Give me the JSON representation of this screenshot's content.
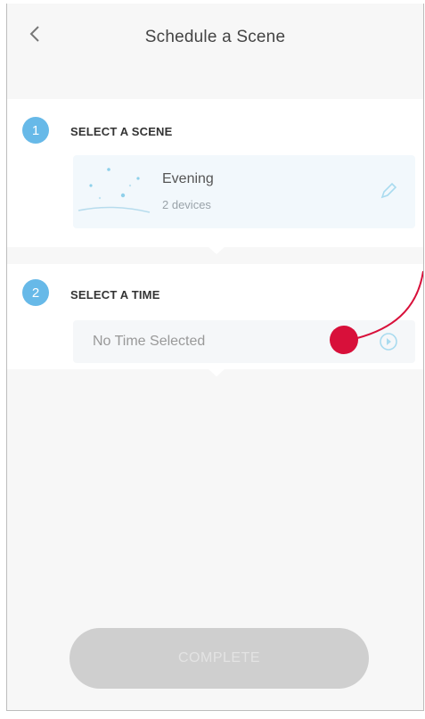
{
  "header": {
    "title": "Schedule a Scene",
    "back_icon": "chevron-left-icon"
  },
  "steps": [
    {
      "number": "1",
      "label": "SELECT A SCENE"
    },
    {
      "number": "2",
      "label": "SELECT A TIME"
    }
  ],
  "scene": {
    "name": "Evening",
    "devices": "2 devices",
    "edit_icon": "pencil-icon",
    "art_icon": "sparkle-scene-icon"
  },
  "time": {
    "value": "No Time Selected",
    "expand_icon": "circle-arrow-right-icon"
  },
  "footer": {
    "complete_label": "COMPLETE"
  },
  "colors": {
    "accent": "#67b9e8",
    "marker": "#d8103a",
    "button_disabled": "#cfcfcf",
    "background": "#f7f7f7"
  }
}
